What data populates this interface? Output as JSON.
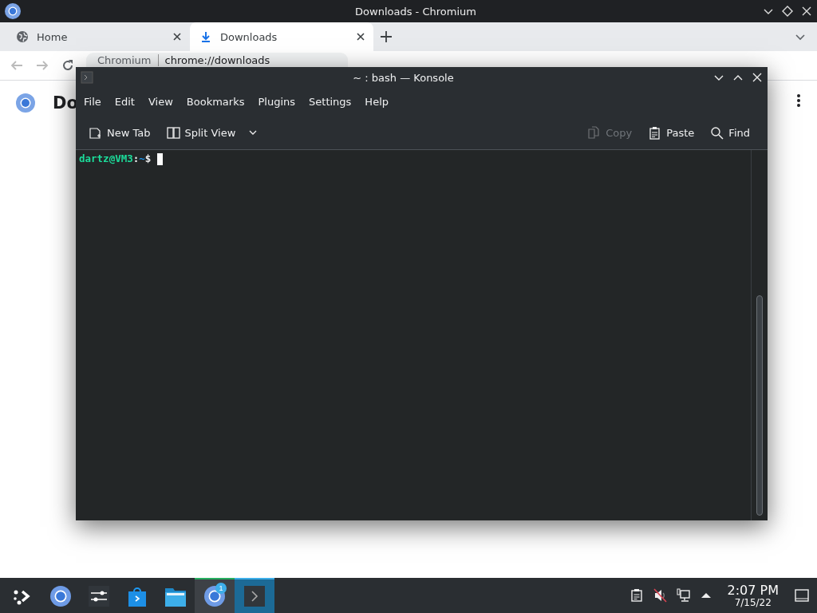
{
  "browser": {
    "title": "Downloads - Chromium",
    "tabs": [
      {
        "label": "Home",
        "kind": "home",
        "selected": false
      },
      {
        "label": "Downloads",
        "kind": "download",
        "selected": true
      }
    ],
    "address": {
      "site": "Chromium",
      "url": "chrome://downloads"
    },
    "page_heading": "Do"
  },
  "konsole": {
    "title": "~ : bash — Konsole",
    "menu": [
      "File",
      "Edit",
      "View",
      "Bookmarks",
      "Plugins",
      "Settings",
      "Help"
    ],
    "toolbar_left": [
      {
        "label": "New Tab",
        "kind": "newtab",
        "disabled": false
      },
      {
        "label": "Split View",
        "kind": "split",
        "disabled": false
      }
    ],
    "toolbar_right": [
      {
        "label": "Copy",
        "kind": "copy",
        "disabled": true
      },
      {
        "label": "Paste",
        "kind": "paste",
        "disabled": false
      },
      {
        "label": "Find",
        "kind": "find",
        "disabled": false
      }
    ],
    "prompt": {
      "user_host": "dartz@VM3",
      "separator": ":",
      "path": "~",
      "symbol": "$"
    }
  },
  "taskbar": {
    "items": [
      {
        "kind": "launcher",
        "open": false,
        "selected": false
      },
      {
        "kind": "chromium",
        "open": false,
        "selected": false
      },
      {
        "kind": "settings",
        "open": false,
        "selected": false
      },
      {
        "kind": "store",
        "open": false,
        "selected": false
      },
      {
        "kind": "files",
        "open": false,
        "selected": false
      },
      {
        "kind": "chromium",
        "open": true,
        "selected": false,
        "badge": "1"
      },
      {
        "kind": "konsole",
        "open": true,
        "selected": true
      }
    ],
    "tray": [
      {
        "kind": "clipboard"
      },
      {
        "kind": "muted"
      },
      {
        "kind": "network"
      },
      {
        "kind": "expand"
      }
    ],
    "time": "2:07 PM",
    "date": "7/15/22"
  }
}
